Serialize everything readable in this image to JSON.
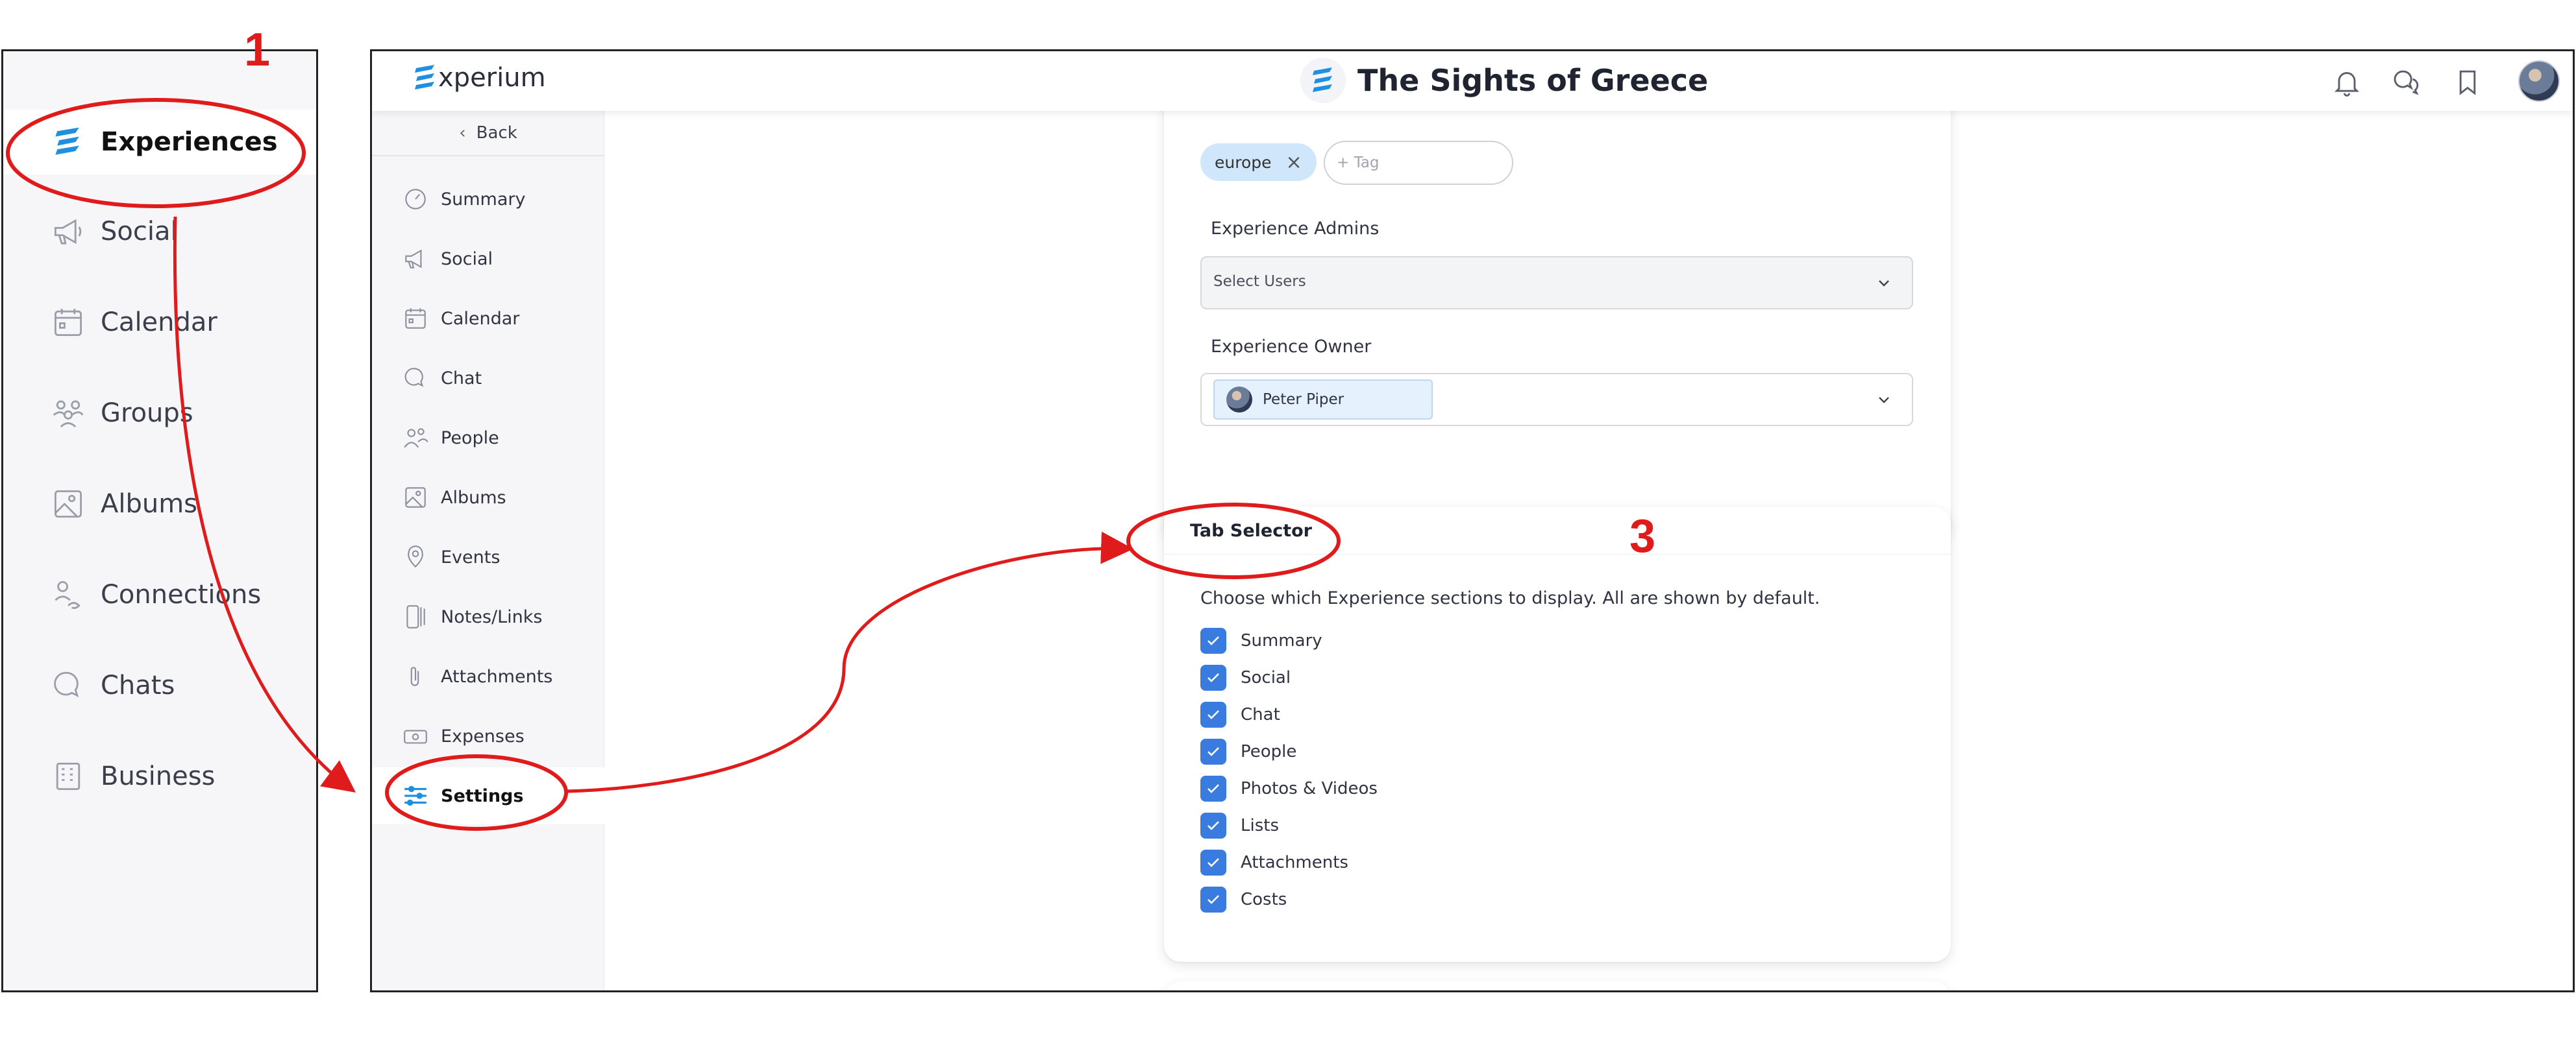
{
  "zoom_panel": {
    "items": [
      {
        "label": "Experiences",
        "icon": "experium-logo-icon",
        "active": true
      },
      {
        "label": "Social",
        "icon": "megaphone-icon"
      },
      {
        "label": "Calendar",
        "icon": "calendar-icon"
      },
      {
        "label": "Groups",
        "icon": "groups-icon"
      },
      {
        "label": "Albums",
        "icon": "image-icon"
      },
      {
        "label": "Connections",
        "icon": "connections-icon"
      },
      {
        "label": "Chats",
        "icon": "chat-bubbles-icon"
      },
      {
        "label": "Business",
        "icon": "building-icon"
      }
    ]
  },
  "header": {
    "logo_text": "xperium",
    "title": "The Sights of Greece",
    "icons": [
      "bell-icon",
      "chat-bubbles-icon",
      "bookmark-icon",
      "user-avatar"
    ]
  },
  "sidebar": {
    "back_label": "Back",
    "items": [
      {
        "label": "Summary",
        "icon": "gauge-icon"
      },
      {
        "label": "Social",
        "icon": "megaphone-icon"
      },
      {
        "label": "Calendar",
        "icon": "calendar-icon"
      },
      {
        "label": "Chat",
        "icon": "chat-bubbles-icon"
      },
      {
        "label": "People",
        "icon": "people-icon"
      },
      {
        "label": "Albums",
        "icon": "image-icon"
      },
      {
        "label": "Events",
        "icon": "location-pin-icon"
      },
      {
        "label": "Notes/Links",
        "icon": "notes-icon"
      },
      {
        "label": "Attachments",
        "icon": "paperclip-icon"
      },
      {
        "label": "Expenses",
        "icon": "money-icon"
      },
      {
        "label": "Settings",
        "icon": "sliders-icon",
        "active": true
      }
    ]
  },
  "settings_card": {
    "tag": "europe",
    "tag_placeholder": "+ Tag",
    "admins_label": "Experience Admins",
    "admins_placeholder": "Select Users",
    "owner_label": "Experience Owner",
    "owner_name": "Peter Piper"
  },
  "tab_selector": {
    "title": "Tab Selector",
    "description": "Choose which Experience sections to display. All are shown by default.",
    "options": [
      {
        "label": "Summary",
        "checked": true
      },
      {
        "label": "Social",
        "checked": true
      },
      {
        "label": "Chat",
        "checked": true
      },
      {
        "label": "People",
        "checked": true
      },
      {
        "label": "Photos & Videos",
        "checked": true
      },
      {
        "label": "Lists",
        "checked": true
      },
      {
        "label": "Attachments",
        "checked": true
      },
      {
        "label": "Costs",
        "checked": true
      }
    ]
  },
  "annotations": {
    "step_1": "1",
    "step_3": "3",
    "color": "#e01b1b"
  },
  "colors": {
    "accent": "#3a7be0",
    "logo_blue": "#1f8fe0",
    "sidebar_bg": "#f6f6f8"
  }
}
